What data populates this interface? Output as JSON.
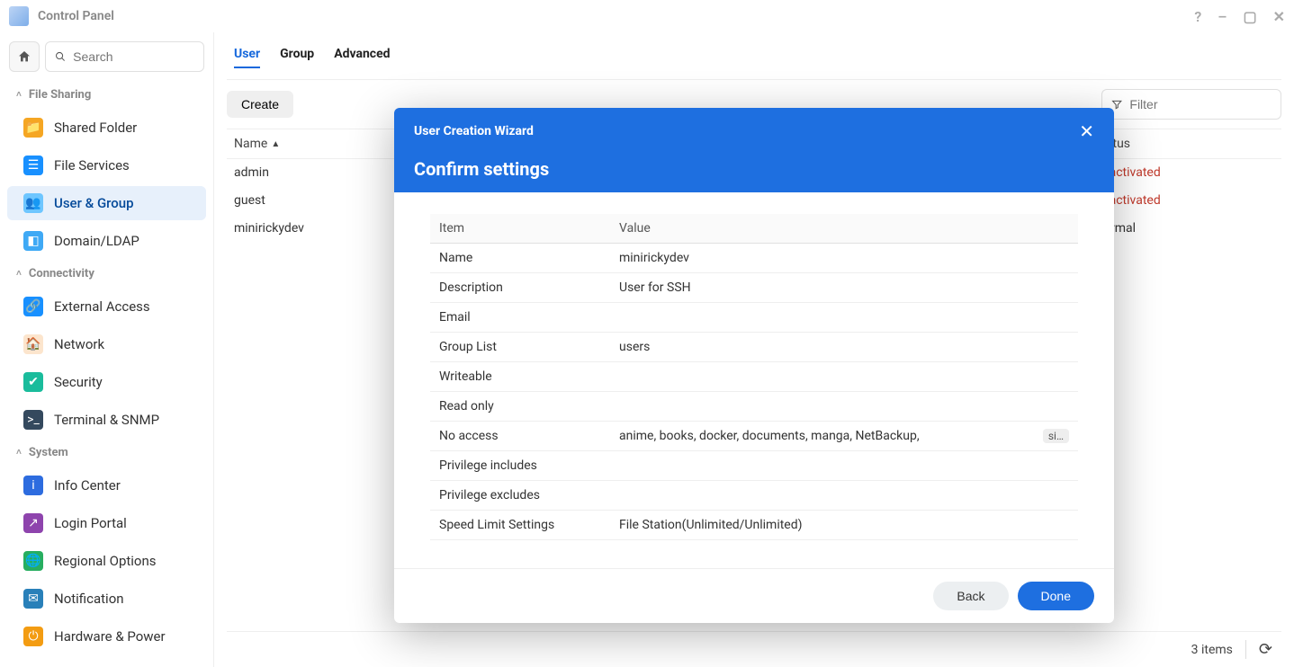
{
  "window": {
    "title": "Control Panel"
  },
  "sidebar": {
    "search_placeholder": "Search",
    "sections": {
      "file_sharing": "File Sharing",
      "connectivity": "Connectivity",
      "system": "System"
    },
    "items": {
      "shared_folder": "Shared Folder",
      "file_services": "File Services",
      "user_group": "User & Group",
      "domain_ldap": "Domain/LDAP",
      "external_access": "External Access",
      "network": "Network",
      "security": "Security",
      "terminal_snmp": "Terminal & SNMP",
      "info_center": "Info Center",
      "login_portal": "Login Portal",
      "regional_options": "Regional Options",
      "notification": "Notification",
      "hardware_power": "Hardware & Power"
    }
  },
  "tabs": {
    "user": "User",
    "group": "Group",
    "advanced": "Advanced"
  },
  "toolbar": {
    "create": "Create",
    "filter_placeholder": "Filter"
  },
  "table": {
    "header_name": "Name",
    "header_status": "Status",
    "rows": [
      {
        "name": "admin",
        "status": "Deactivated",
        "status_class": "deact"
      },
      {
        "name": "guest",
        "status": "Deactivated",
        "status_class": "deact"
      },
      {
        "name": "minirickydev",
        "status": "Normal",
        "status_class": "normal"
      }
    ]
  },
  "footer": {
    "count": "3 items"
  },
  "modal": {
    "wizard_title": "User Creation Wizard",
    "heading": "Confirm settings",
    "item_header": "Item",
    "value_header": "Value",
    "rows": [
      {
        "item": "Name",
        "value": "minirickydev",
        "badge": ""
      },
      {
        "item": "Description",
        "value": "User for SSH",
        "badge": ""
      },
      {
        "item": "Email",
        "value": "",
        "badge": ""
      },
      {
        "item": "Group List",
        "value": "users",
        "badge": ""
      },
      {
        "item": "Writeable",
        "value": "",
        "badge": ""
      },
      {
        "item": "Read only",
        "value": "",
        "badge": ""
      },
      {
        "item": "No access",
        "value": "anime, books, docker, documents, manga, NetBackup,",
        "badge": "si…"
      },
      {
        "item": "Privilege includes",
        "value": "",
        "badge": ""
      },
      {
        "item": "Privilege excludes",
        "value": "",
        "badge": ""
      },
      {
        "item": "Speed Limit Settings",
        "value": "File Station(Unlimited/Unlimited)",
        "badge": ""
      }
    ],
    "back": "Back",
    "done": "Done"
  }
}
